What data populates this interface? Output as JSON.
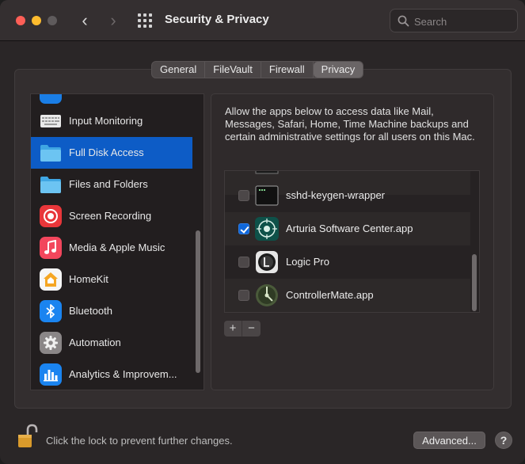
{
  "window": {
    "title": "Security & Privacy",
    "search_placeholder": "Search"
  },
  "tabs": [
    {
      "label": "General",
      "active": false
    },
    {
      "label": "FileVault",
      "active": false
    },
    {
      "label": "Firewall",
      "active": false
    },
    {
      "label": "Privacy",
      "active": true
    }
  ],
  "sidebar": {
    "items": [
      {
        "label": "Input Monitoring",
        "icon": "keyboard-icon",
        "selected": false
      },
      {
        "label": "Full Disk Access",
        "icon": "folder-icon",
        "selected": true
      },
      {
        "label": "Files and Folders",
        "icon": "folder-icon",
        "selected": false
      },
      {
        "label": "Screen Recording",
        "icon": "screen-record-icon",
        "selected": false
      },
      {
        "label": "Media & Apple Music",
        "icon": "music-note-icon",
        "selected": false
      },
      {
        "label": "HomeKit",
        "icon": "home-icon",
        "selected": false
      },
      {
        "label": "Bluetooth",
        "icon": "bluetooth-icon",
        "selected": false
      },
      {
        "label": "Automation",
        "icon": "gear-icon",
        "selected": false
      },
      {
        "label": "Analytics & Improvem...",
        "icon": "bar-chart-icon",
        "selected": false
      }
    ]
  },
  "panel": {
    "description": "Allow the apps below to access data like Mail, Messages, Safari, Home, Time Machine backups and certain administrative settings for all users on this Mac.",
    "apps": [
      {
        "label": "sshd-keygen-wrapper",
        "checked": false,
        "icon": "terminal-icon"
      },
      {
        "label": "Arturia Software Center.app",
        "checked": true,
        "icon": "arturia-icon"
      },
      {
        "label": "Logic Pro",
        "checked": false,
        "icon": "logic-pro-icon"
      },
      {
        "label": "ControllerMate.app",
        "checked": false,
        "icon": "controllermate-icon"
      }
    ],
    "add_label": "+",
    "remove_label": "−"
  },
  "footer": {
    "lock_text": "Click the lock to prevent further changes.",
    "advanced_label": "Advanced...",
    "help_label": "?"
  },
  "colors": {
    "accent": "#0d5cc6",
    "checkbox_on": "#0f67da",
    "window_bg": "#2a2627"
  }
}
